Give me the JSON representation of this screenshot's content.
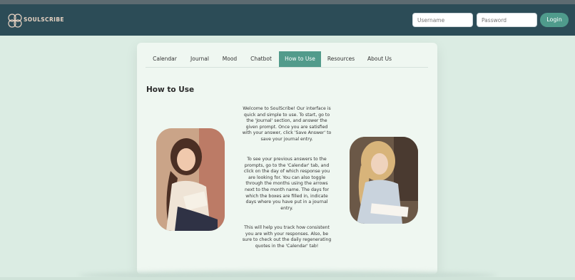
{
  "header": {
    "brand": "SOULSCRIBE",
    "username_placeholder": "Username",
    "password_placeholder": "Password",
    "login_label": "Login"
  },
  "tabs": [
    {
      "label": "Calendar"
    },
    {
      "label": "Journal"
    },
    {
      "label": "Mood"
    },
    {
      "label": "Chatbot"
    },
    {
      "label": "How to Use",
      "active": true
    },
    {
      "label": "Resources"
    },
    {
      "label": "About Us"
    }
  ],
  "page": {
    "title": "How to Use",
    "paragraphs": [
      "Welcome to SoulScribe! Our interface is quick and simple to use. To start, go to the 'Journal' section, and answer the given prompt. Once you are satisfied with your answer, click 'Save Answer' to save your journal entry.",
      "To see your previous answers to the prompts, go to the 'Calendar' tab, and click on the day of which response you are looking for. You can also toggle through the months using the arrows next to the month name. The days for which the boxes are filled in, indicate days where you have put in a journal entry.",
      "This will help you track how consistent you are with your responses. Also, be sure to check out the daily regenerating quotes in the 'Calendar' tab!"
    ]
  },
  "colors": {
    "header_bg": "#2c4c57",
    "accent": "#529b8b",
    "page_bg": "#dbece3",
    "panel_bg": "#eff7f1"
  }
}
